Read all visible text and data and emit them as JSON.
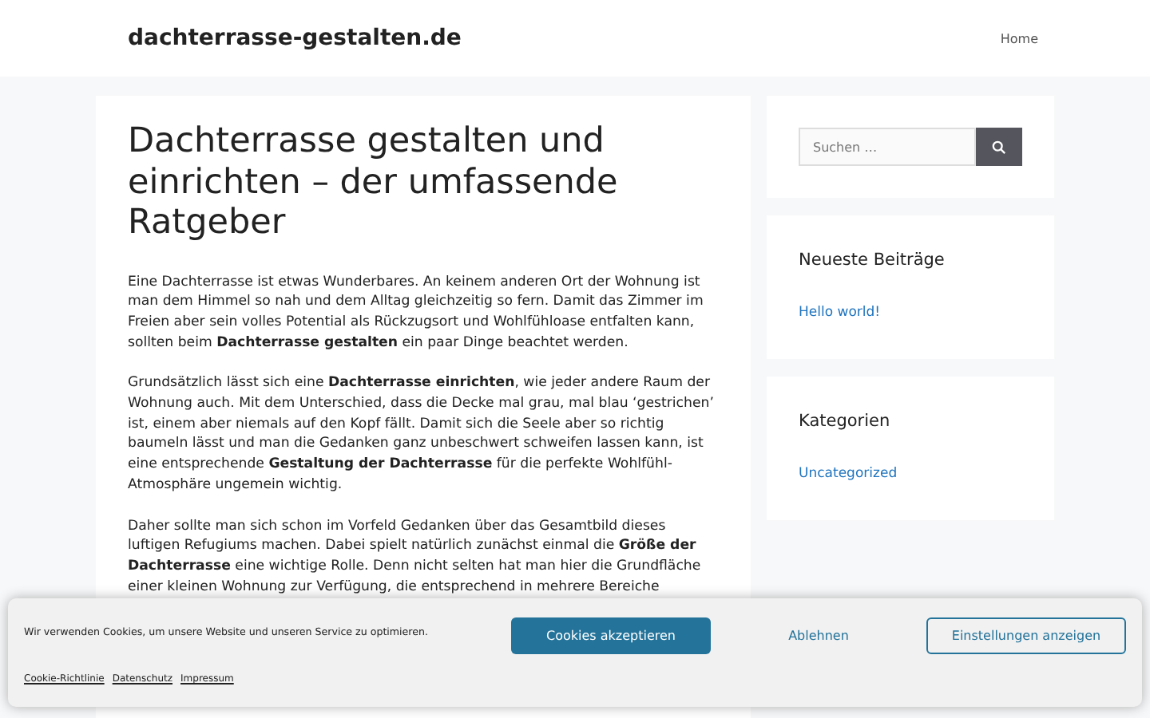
{
  "header": {
    "site_title": "dachterrasse-gestalten.de",
    "nav": [
      {
        "label": "Home"
      }
    ]
  },
  "article": {
    "title": "Dachterrasse gestalten und einrichten – der umfassende Ratgeber",
    "paragraphs": [
      "Eine Dachterrasse ist etwas Wunderbares. An keinem anderen Ort der Wohnung ist man dem Himmel so nah und dem Alltag gleichzeitig so fern. Damit das Zimmer im Freien aber sein volles Potential als Rückzugsort und Wohlfühloase entfalten kann, sollten beim **Dachterrasse gestalten** ein paar Dinge beachtet werden.",
      "Grundsätzlich lässt sich eine **Dachterrasse einrichten**, wie jeder andere Raum der Wohnung auch. Mit dem Unterschied, dass die Decke mal grau, mal blau ‘gestrichen’ ist, einem aber niemals auf den Kopf fällt. Damit sich die Seele aber so richtig baumeln lässt und man die Gedanken ganz unbeschwert schweifen lassen kann, ist eine entsprechende **Gestaltung der Dachterrasse** für die perfekte Wohlfühl-Atmosphäre ungemein wichtig.",
      "Daher sollte man sich schon im Vorfeld Gedanken über das Gesamtbild dieses luftigen Refugiums machen. Dabei spielt natürlich zunächst einmal die **Größe der Dachterrasse** eine wichtige Rolle. Denn nicht selten hat man hier die Grundfläche einer kleinen Wohnung zur Verfügung, die entsprechend in mehrere Bereiche"
    ]
  },
  "sidebar": {
    "search": {
      "placeholder": "Suchen …"
    },
    "widgets": [
      {
        "heading": "Neueste Beiträge",
        "links": [
          "Hello world!"
        ]
      },
      {
        "heading": "Kategorien",
        "links": [
          "Uncategorized"
        ]
      }
    ]
  },
  "cookie_banner": {
    "message": "Wir verwenden Cookies, um unsere Website und unseren Service zu optimieren.",
    "buttons": [
      {
        "label": "Cookies akzeptieren",
        "kind": "primary"
      },
      {
        "label": "Ablehnen",
        "kind": "plain"
      },
      {
        "label": "Einstellungen anzeigen",
        "kind": "outline"
      }
    ],
    "links": [
      "Cookie-Richtlinie",
      "Datenschutz",
      "Impressum"
    ]
  }
}
